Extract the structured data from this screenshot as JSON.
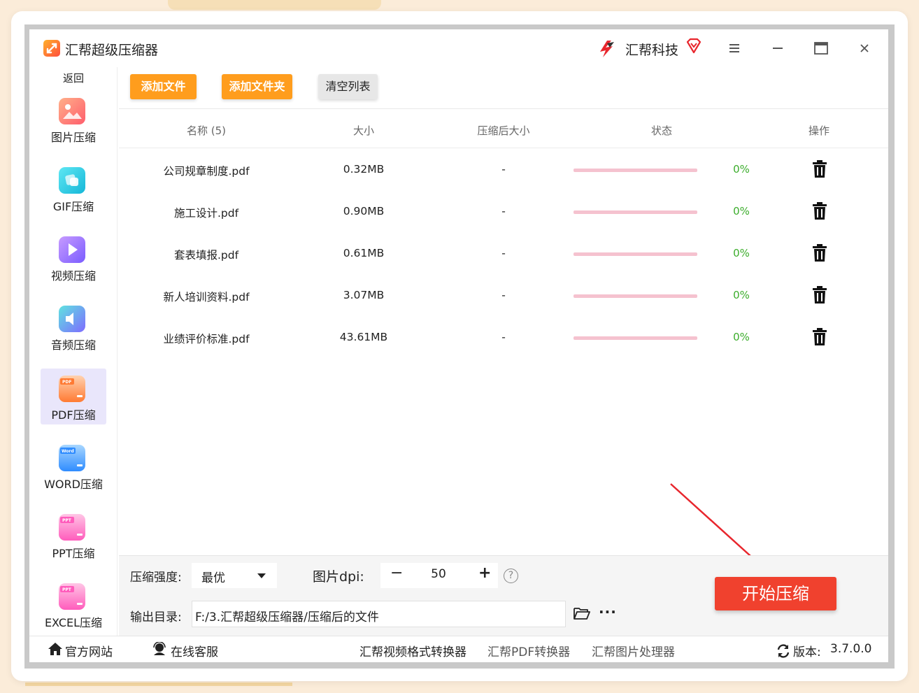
{
  "app": {
    "title": "汇帮超级压缩器",
    "brand": "汇帮科技",
    "back": "返回"
  },
  "icons": {
    "window_controls": [
      "menu-icon",
      "minimize-icon",
      "maximize-icon",
      "close-icon"
    ]
  },
  "sidebar": {
    "items": [
      {
        "label": "图片压缩",
        "icon": "image-icon",
        "active": false
      },
      {
        "label": "GIF压缩",
        "icon": "gif-icon",
        "active": false
      },
      {
        "label": "视频压缩",
        "icon": "video-icon",
        "active": false
      },
      {
        "label": "音频压缩",
        "icon": "audio-icon",
        "active": false
      },
      {
        "label": "PDF压缩",
        "icon": "pdf-icon",
        "active": true
      },
      {
        "label": "WORD压缩",
        "icon": "word-icon",
        "active": false
      },
      {
        "label": "PPT压缩",
        "icon": "ppt-icon",
        "active": false
      },
      {
        "label": "EXCEL压缩",
        "icon": "excel-icon",
        "active": false
      }
    ]
  },
  "toolbar": {
    "add_file": "添加文件",
    "add_folder": "添加文件夹",
    "clear_list": "清空列表"
  },
  "table": {
    "headers": {
      "name": "名称 (5)",
      "size": "大小",
      "compressed_size": "压缩后大小",
      "status": "状态",
      "action": "操作"
    },
    "rows": [
      {
        "name": "公司规章制度.pdf",
        "size": "0.32MB",
        "compressed": "-",
        "progress": 0,
        "percent": "0%"
      },
      {
        "name": "施工设计.pdf",
        "size": "0.90MB",
        "compressed": "-",
        "progress": 0,
        "percent": "0%"
      },
      {
        "name": "套表填报.pdf",
        "size": "0.61MB",
        "compressed": "-",
        "progress": 0,
        "percent": "0%"
      },
      {
        "name": "新人培训资料.pdf",
        "size": "3.07MB",
        "compressed": "-",
        "progress": 0,
        "percent": "0%"
      },
      {
        "name": "业绩评价标准.pdf",
        "size": "43.61MB",
        "compressed": "-",
        "progress": 0,
        "percent": "0%"
      }
    ]
  },
  "settings": {
    "strength_label": "压缩强度:",
    "strength_value": "最优",
    "dpi_label": "图片dpi:",
    "dpi_value": "50",
    "dpi_minus": "−",
    "dpi_plus": "+",
    "help": "?",
    "output_label": "输出目录:",
    "output_path": "F:/3.汇帮超级压缩器/压缩后的文件",
    "more": "···"
  },
  "start_button": "开始压缩",
  "footer": {
    "website": "官方网站",
    "support": "在线客服",
    "video_converter": "汇帮视频格式转换器",
    "pdf_converter": "汇帮PDF转换器",
    "image_processor": "汇帮图片处理器",
    "version_label": "版本:",
    "version": "3.7.0.0"
  },
  "colors": {
    "accent_orange": "#ff9d1d",
    "start_red": "#f0412e",
    "percent_green": "#3cad2c",
    "progress_pink": "#f5c2cf",
    "active_nav": "#e9e6fb"
  }
}
